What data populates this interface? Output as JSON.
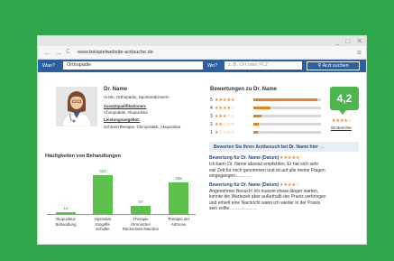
{
  "browser": {
    "url": "www.beispielwebsite-arztsuche.de",
    "back_icon": "←",
    "forward_icon": "→",
    "reload_icon": "C",
    "menu_icon": "≡",
    "window_controls": [
      "_",
      "□",
      "✕"
    ]
  },
  "search": {
    "was_label": "Was?",
    "was_value": "Orthopädie",
    "wo_label": "Wo?",
    "wo_placeholder": "z. B. Ort oder PLZ",
    "button_label": "Arzt suchen"
  },
  "doctor": {
    "name": "Dr. Name",
    "specialties": "Ärztin, Orthopädin, Sportmedizinerin",
    "qual_label": "Zusatzqualifikationen:",
    "qual_value": "Chiropraktik, Akupunktur",
    "services_label": "Leistungsangebot:",
    "services_value": "Schmerztherapie, Chiropraktik, Akupunktur"
  },
  "ratings": {
    "heading": "Bewertungen zu Dr. Name",
    "rows": [
      {
        "label": "5",
        "stars": "★★★★★",
        "fill": 0.95
      },
      {
        "label": "4",
        "stars": "★★★★☆",
        "fill": 0.25
      },
      {
        "label": "3",
        "stars": "★★★☆☆",
        "fill": 0.12
      },
      {
        "label": "2",
        "stars": "★★☆☆☆",
        "fill": 0.08
      },
      {
        "label": "1",
        "stars": "★☆☆☆☆",
        "fill": 0.06
      }
    ],
    "score": "4,2",
    "score_stars": "★★★★☆",
    "count_link": "56 Berichte",
    "colors": {
      "bar": "#e8821e",
      "score": "#4bb64b"
    }
  },
  "chart_data": {
    "type": "bar",
    "title": "Häufigkeiten von Behandlungen",
    "categories": [
      "Akupunktur-Behandlung",
      "Operative Eingriffe Schulter",
      "Therapie chronischer Rückenbeschwerden",
      "Therapie der Arthrose"
    ],
    "category_lines": [
      [
        "Akupunktur-",
        "Behandlung"
      ],
      [
        "Operative",
        "Eingriffe",
        "Schulter"
      ],
      [
        "Therapie",
        "chronischer",
        "Rückenbeschwerden"
      ],
      [
        "Therapie der",
        "Arthrose"
      ]
    ],
    "values": [
      12,
      324,
      67,
      265
    ],
    "ylim": [
      0,
      324
    ],
    "color": "#5cc14a"
  },
  "reviews": {
    "header": "Bewerten Sie Ihren Arztbesuch bei Dr. Name hier →",
    "items": [
      {
        "title": "Bewertung für Dr. Name (Datum)",
        "stars": "★★★★★",
        "lines": [
          "Ich kann Dr. Name absolut empfehlen. Er hat sich sehr",
          "viel Zeit für mich genommen und ist auf alle meine Fragen",
          "eingegangen……….."
        ]
      },
      {
        "title": "Bewertung für Dr. Name (Datum)",
        "stars": "★★★★☆",
        "lines": [
          "Angenehmer Besuch! Ich musste etwas länger warten,",
          "konnte die Wartezeit aber außerhalb der Praxis verbringen",
          "und erhielt eine Nachricht wann ich wieder in der Praxis",
          "sein sollte. …………….."
        ]
      }
    ]
  }
}
